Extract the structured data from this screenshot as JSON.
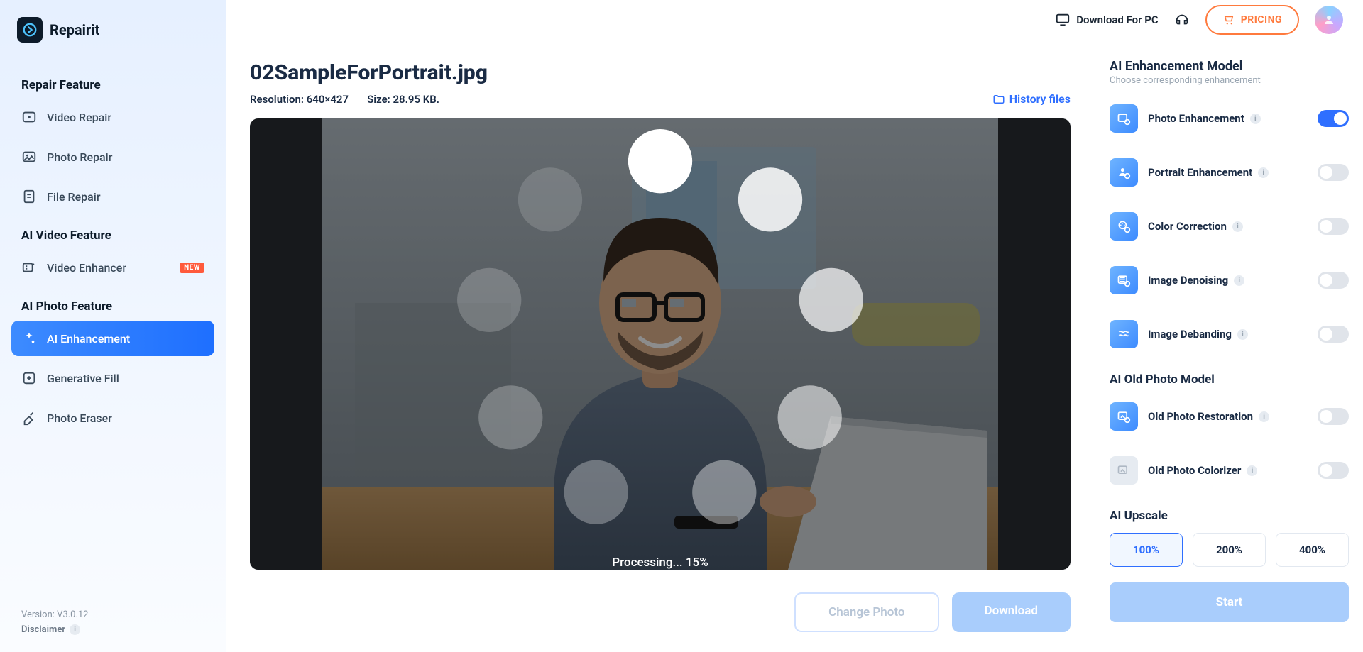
{
  "app": {
    "name": "Repairit"
  },
  "sidebar": {
    "sections": [
      {
        "label": "Repair Feature",
        "items": [
          {
            "label": "Video Repair"
          },
          {
            "label": "Photo Repair"
          },
          {
            "label": "File Repair"
          }
        ]
      },
      {
        "label": "AI Video Feature",
        "items": [
          {
            "label": "Video Enhancer",
            "badge": "NEW"
          }
        ]
      },
      {
        "label": "AI Photo Feature",
        "items": [
          {
            "label": "AI Enhancement",
            "active": true
          },
          {
            "label": "Generative Fill"
          },
          {
            "label": "Photo Eraser"
          }
        ]
      }
    ],
    "version": "Version: V3.0.12",
    "disclaimer": "Disclaimer"
  },
  "topbar": {
    "download": "Download For PC",
    "pricing": "PRICING"
  },
  "center": {
    "filename": "02SampleForPortrait.jpg",
    "resolution": "Resolution: 640×427",
    "size": "Size: 28.95 KB.",
    "history": "History files",
    "processing": "Processing... 15%",
    "change": "Change Photo",
    "download": "Download"
  },
  "panel": {
    "head1": "AI Enhancement Model",
    "sub1": "Choose corresponding enhancement",
    "models": [
      {
        "label": "Photo Enhancement",
        "on": true
      },
      {
        "label": "Portrait Enhancement",
        "on": false
      },
      {
        "label": "Color Correction",
        "on": false
      },
      {
        "label": "Image Denoising",
        "on": false
      },
      {
        "label": "Image Debanding",
        "on": false
      }
    ],
    "head2": "AI Old Photo Model",
    "oldmodels": [
      {
        "label": "Old Photo Restoration",
        "on": false
      },
      {
        "label": "Old Photo Colorizer",
        "on": false,
        "grey": true
      }
    ],
    "head3": "AI Upscale",
    "upscale": [
      "100%",
      "200%",
      "400%"
    ],
    "start": "Start"
  }
}
